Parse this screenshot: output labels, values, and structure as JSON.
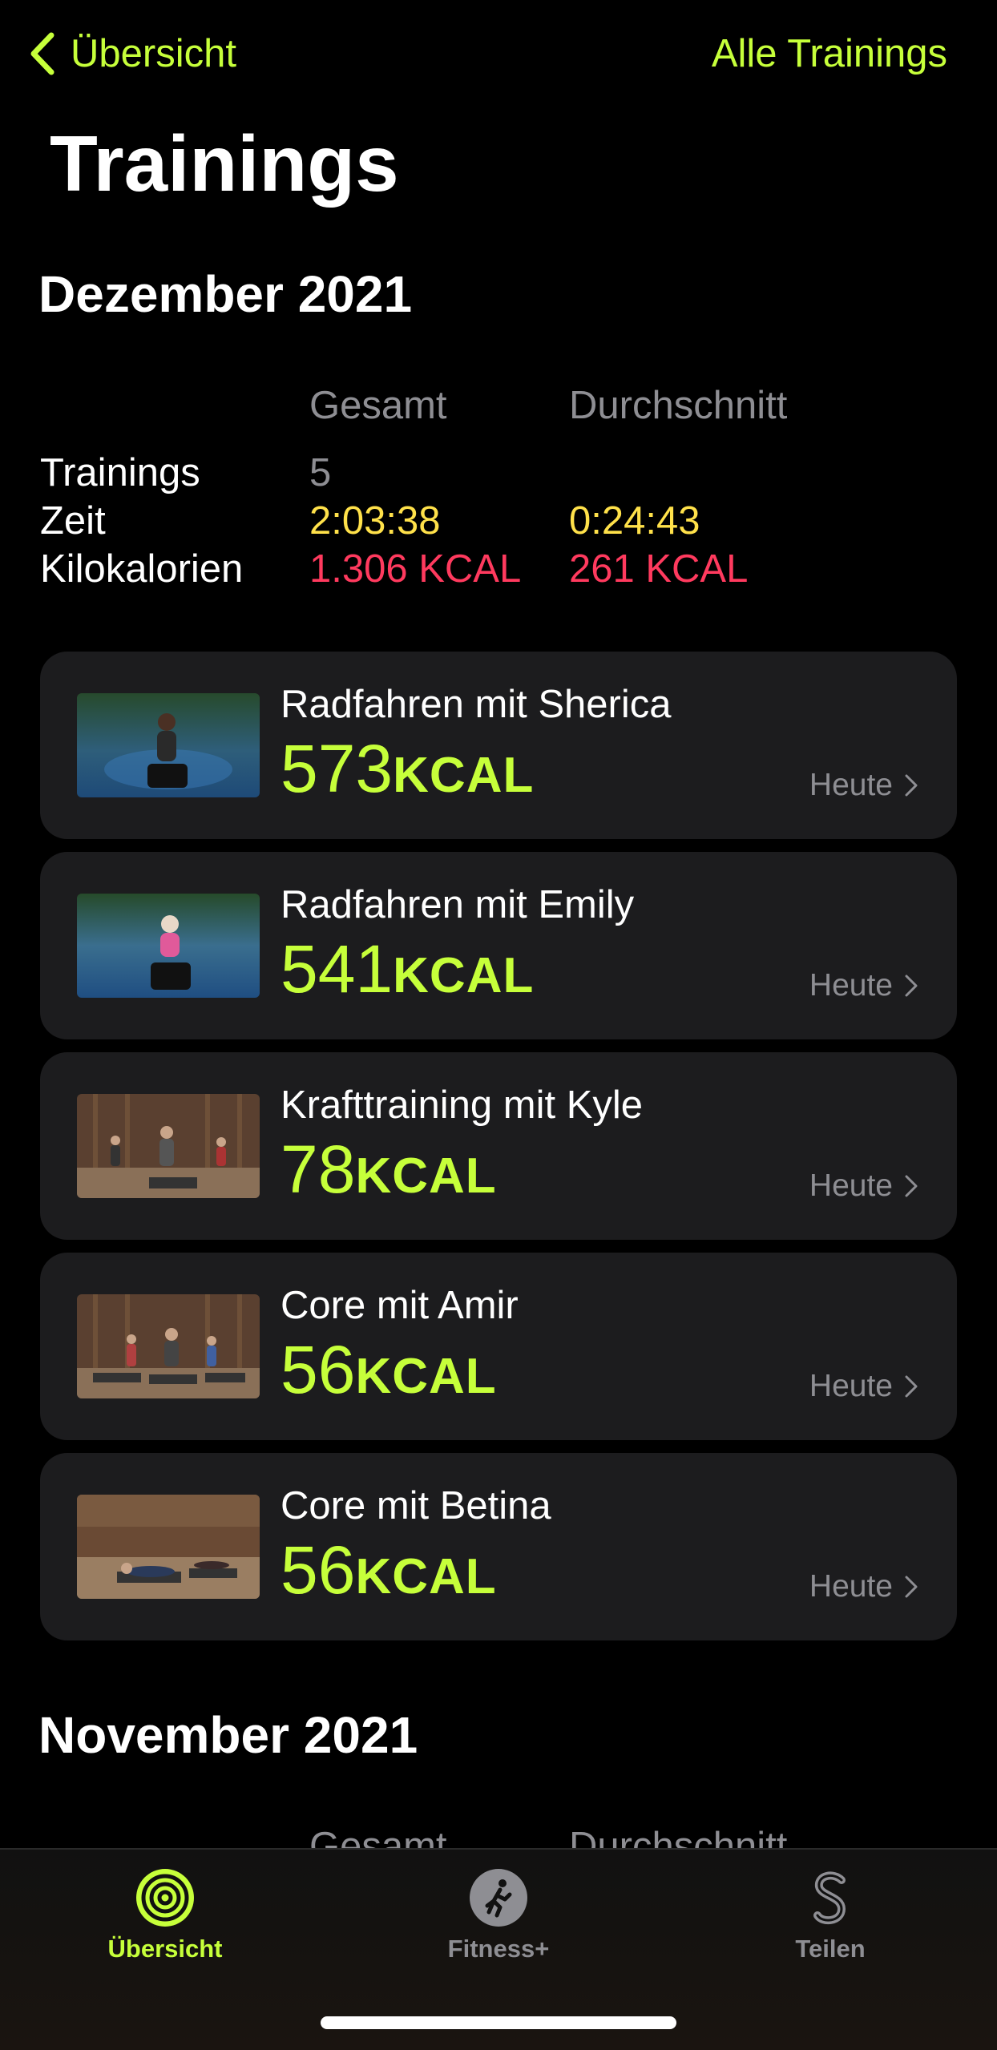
{
  "nav": {
    "back_label": "Übersicht",
    "right_label": "Alle Trainings"
  },
  "title": "Trainings",
  "months": [
    {
      "title": "Dezember 2021",
      "col_total": "Gesamt",
      "col_average": "Durchschnitt",
      "rows": [
        {
          "label": "Trainings",
          "total": "5",
          "average": ""
        },
        {
          "label": "Zeit",
          "total": "2:03:38",
          "average": "0:24:43"
        },
        {
          "label": "Kilokalorien",
          "total": "1.306 KCAL",
          "average": "261 KCAL"
        }
      ]
    },
    {
      "title": "November 2021",
      "col_total": "Gesamt",
      "col_average": "Durchschnitt"
    }
  ],
  "workouts": [
    {
      "title": "Radfahren mit Sherica",
      "kcal": "573",
      "unit": "KCAL",
      "date": "Heute"
    },
    {
      "title": "Radfahren mit Emily",
      "kcal": "541",
      "unit": "KCAL",
      "date": "Heute"
    },
    {
      "title": "Krafttraining mit Kyle",
      "kcal": "78",
      "unit": "KCAL",
      "date": "Heute"
    },
    {
      "title": "Core mit Amir",
      "kcal": "56",
      "unit": "KCAL",
      "date": "Heute"
    },
    {
      "title": "Core mit Betina",
      "kcal": "56",
      "unit": "KCAL",
      "date": "Heute"
    }
  ],
  "tabs": [
    {
      "label": "Übersicht",
      "icon": "activity-rings-icon",
      "active": true
    },
    {
      "label": "Fitness+",
      "icon": "runner-icon",
      "active": false
    },
    {
      "label": "Teilen",
      "icon": "sharing-icon",
      "active": false
    }
  ],
  "colors": {
    "accent": "#c6ff3a",
    "time": "#ffe14a",
    "calories": "#ff3a5e",
    "secondary": "#8e8e93",
    "card": "#1c1c1e"
  }
}
